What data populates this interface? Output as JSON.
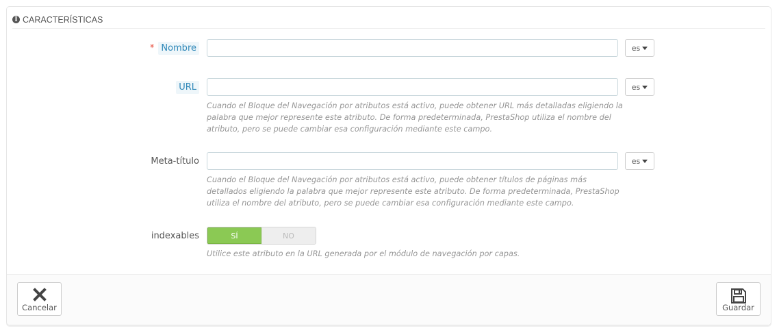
{
  "panel": {
    "title": "CARACTERÍSTICAS",
    "icon": "info-icon"
  },
  "fields": {
    "nombre": {
      "required_mark": "*",
      "label": "Nombre",
      "value": "",
      "lang": "es"
    },
    "url": {
      "label": "URL",
      "value": "",
      "lang": "es",
      "help": "Cuando el Bloque del Navegación por atributos está activo, puede obtener URL más detalladas eligiendo la palabra que mejor represente este atributo. De forma predeterminada, PrestaShop utiliza el nombre del atributo, pero se puede cambiar esa configuración mediante este campo."
    },
    "meta_titulo": {
      "label": "Meta-título",
      "value": "",
      "lang": "es",
      "help": "Cuando el Bloque del Navegación por atributos está activo, puede obtener títulos de páginas más detallados eligiendo la palabra que mejor represente este atributo. De forma predeterminada, PrestaShop utiliza el nombre del atributo, pero se puede cambiar esa configuración mediante este campo."
    },
    "indexables": {
      "label": "indexables",
      "yes_label": "SÍ",
      "no_label": "NO",
      "selected": "SÍ",
      "help": "Utilice este atributo en la URL generada por el módulo de navegación por capas."
    }
  },
  "footer": {
    "cancel_label": "Cancelar",
    "save_label": "Guardar"
  },
  "colors": {
    "switch_on": "#8bc954",
    "required": "#e74c3c",
    "label_highlight": "#2e87b8"
  }
}
